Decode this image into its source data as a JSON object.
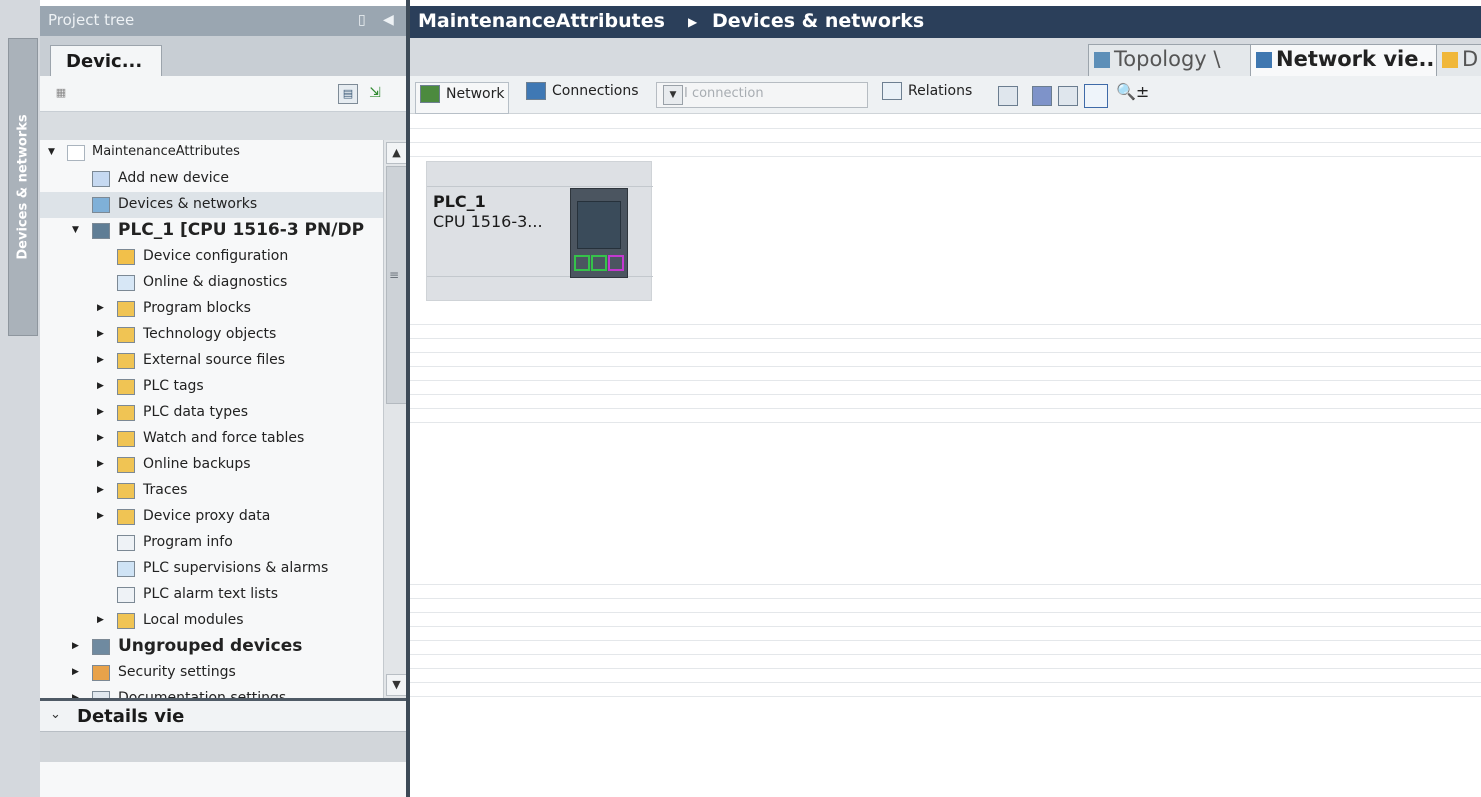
{
  "sidebar_tab": {
    "label": "Devices & networks"
  },
  "project_tree": {
    "header_title": "Project tree",
    "tab_label": "Devic...",
    "items": [
      {
        "label": "MaintenanceAttributes",
        "expander": "expanded",
        "level": 0
      },
      {
        "label": "Add new device",
        "expander": "none",
        "level": 1
      },
      {
        "label": "Devices & networks",
        "expander": "none",
        "level": 1,
        "selected": true
      },
      {
        "label": "PLC_1 [CPU 1516-3 PN/DP",
        "expander": "expanded",
        "level": 1,
        "bold": true
      },
      {
        "label": "Device configuration",
        "expander": "none",
        "level": 2
      },
      {
        "label": "Online & diagnostics",
        "expander": "none",
        "level": 2
      },
      {
        "label": "Program blocks",
        "expander": "collapsed",
        "level": 2
      },
      {
        "label": "Technology objects",
        "expander": "collapsed",
        "level": 2
      },
      {
        "label": "External source files",
        "expander": "collapsed",
        "level": 2
      },
      {
        "label": "PLC tags",
        "expander": "collapsed",
        "level": 2
      },
      {
        "label": "PLC data types",
        "expander": "collapsed",
        "level": 2
      },
      {
        "label": "Watch and force tables",
        "expander": "collapsed",
        "level": 2
      },
      {
        "label": "Online backups",
        "expander": "collapsed",
        "level": 2
      },
      {
        "label": "Traces",
        "expander": "collapsed",
        "level": 2
      },
      {
        "label": "Device proxy data",
        "expander": "collapsed",
        "level": 2
      },
      {
        "label": "Program info",
        "expander": "none",
        "level": 2
      },
      {
        "label": "PLC supervisions & alarms",
        "expander": "none",
        "level": 2
      },
      {
        "label": "PLC alarm text lists",
        "expander": "none",
        "level": 2
      },
      {
        "label": "Local modules",
        "expander": "collapsed",
        "level": 2
      },
      {
        "label": "Ungrouped devices",
        "expander": "collapsed",
        "level": 1,
        "bold": true
      },
      {
        "label": "Security settings",
        "expander": "collapsed",
        "level": 1
      },
      {
        "label": "Documentation settings",
        "expander": "collapsed",
        "level": 1
      }
    ]
  },
  "details_view": {
    "title": "Details vie"
  },
  "editor": {
    "breadcrumb": [
      "MaintenanceAttributes",
      "Devices & networks"
    ],
    "view_tabs": [
      {
        "label": "Topology \\",
        "active": false
      },
      {
        "label": "Network vie...",
        "active": true
      },
      {
        "label": "D",
        "active": false
      }
    ],
    "toolbar": {
      "network_label": "Network",
      "connections_label": "Connections",
      "hmi_connection_placeholder": "HMI connection",
      "relations_label": "Relations",
      "zoom_label": "±"
    }
  },
  "device": {
    "name": "PLC_1",
    "type": "CPU 1516-3...",
    "port_colors": [
      "#35c24a",
      "#35c24a",
      "#c338d0"
    ]
  }
}
